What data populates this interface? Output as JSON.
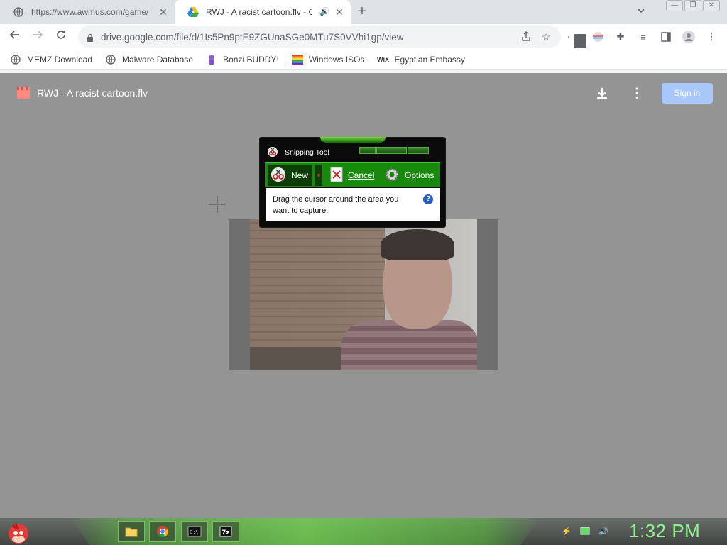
{
  "browser": {
    "tabs": [
      {
        "title": "https://www.awmus.com/game/",
        "close": "✕"
      },
      {
        "title": "RWJ - A racist cartoon.flv - G",
        "close": "✕"
      }
    ],
    "new_tab": "+",
    "address": {
      "url": "drive.google.com/file/d/1Is5Pn9ptE9ZGUnaSGe0MTu7S0VVhi1gp/view"
    },
    "extension_badge": "35"
  },
  "bookmarks": [
    {
      "label": "MEMZ Download",
      "icon": "globe-icon"
    },
    {
      "label": "Malware Database",
      "icon": "globe-icon"
    },
    {
      "label": "Bonzi BUDDY!",
      "icon": "bonzi-icon"
    },
    {
      "label": "Windows ISOs",
      "icon": "windows-flag-icon"
    },
    {
      "label": "Egyptian Embassy",
      "icon": "wix-icon"
    }
  ],
  "drive": {
    "file_title": "RWJ - A racist cartoon.flv",
    "signin_label": "Sign in"
  },
  "snipping_tool": {
    "title": "Snipping Tool",
    "new_label": "New",
    "cancel_label": "Cancel",
    "options_label": "Options",
    "message": "Drag the cursor around the area you want to capture.",
    "help": "?"
  },
  "taskbar": {
    "clock": "1:32 PM",
    "items": [
      "file-explorer-icon",
      "chrome-icon",
      "command-prompt-icon",
      "7zip-icon"
    ]
  },
  "colors": {
    "snip_green": "#178a0b",
    "clock_green": "#8df58d",
    "signin_blue": "#a8c7fa"
  }
}
